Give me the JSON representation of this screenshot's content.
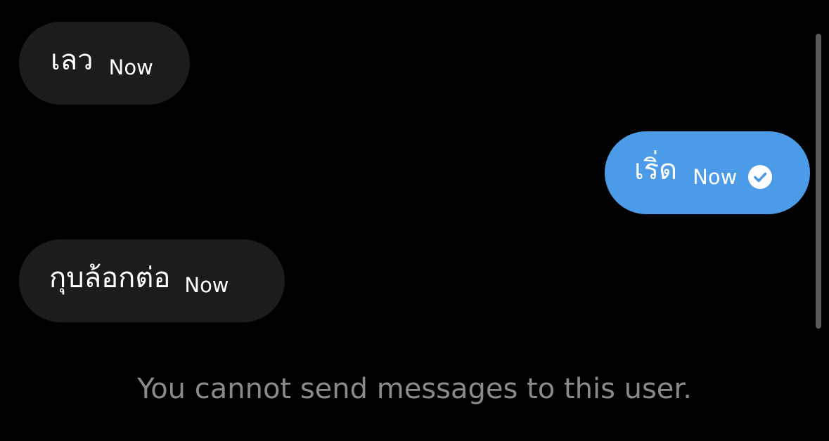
{
  "conversation": {
    "messages": [
      {
        "direction": "incoming",
        "text": "เลว",
        "time": "Now"
      },
      {
        "direction": "outgoing",
        "text": "เริ่ด",
        "time": "Now",
        "status_icon": "read-check-icon"
      },
      {
        "direction": "incoming",
        "text": "กุบล้อกต่อ",
        "time": "Now"
      }
    ]
  },
  "notice": {
    "text": "You cannot send messages to this user."
  },
  "colors": {
    "background": "#000000",
    "incoming_bubble": "#1c1c1e",
    "outgoing_bubble": "#4c9be8",
    "notice_text": "#8a8a8e"
  }
}
